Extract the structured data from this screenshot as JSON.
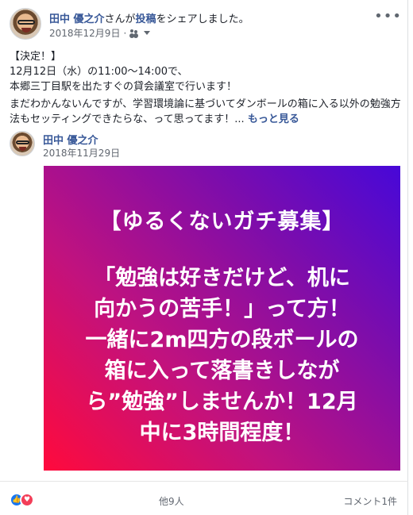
{
  "post": {
    "author": "田中 優之介",
    "action_prefix": "さんが",
    "action_link": "投稿",
    "action_suffix": "をシェアしました。",
    "date": "2018年12月9日",
    "more": "•••",
    "lines": [
      "【決定！】",
      "12月12日（水）の11:00〜14:00で、",
      "本郷三丁目駅を出たすぐの貸会議室で行います！"
    ],
    "paragraph": "まだわかんないんですが、学習環境論に基づいてダンボールの箱に入る以外の勉強方法もセッティングできたらな、って思ってます！... ",
    "see_more": "もっと見る"
  },
  "shared": {
    "author": "田中 優之介",
    "date": "2018年11月29日"
  },
  "image": {
    "heading": "【ゆるくないガチ募集】",
    "message_lines": [
      "「勉強は好きだけど、机に",
      "向かうの苦手！」って方！",
      "一緒に2m四方の段ボールの",
      "箱に入って落書きしなが",
      "ら”勉強”しませんか！12月",
      "中に3時間程度！"
    ],
    "gradient": [
      "#ff0a3c",
      "#c1127e",
      "#7d0dab",
      "#4708d8"
    ]
  },
  "footer": {
    "reaction_icons": [
      "like-icon",
      "love-icon"
    ],
    "reactions_count": "他9人",
    "comments_count": "コメント1件"
  },
  "colors": {
    "link": "#385898",
    "meta": "#616770",
    "like": "#1877f2",
    "love": "#f33e58"
  }
}
